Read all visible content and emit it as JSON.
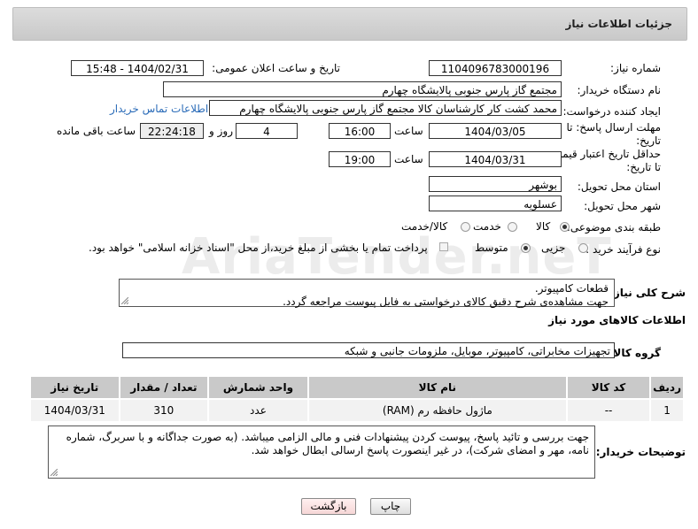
{
  "header": {
    "title": "جزئیات اطلاعات نیاز"
  },
  "fields": {
    "need_number_label": "شماره نیاز:",
    "need_number": "1104096783000196",
    "announce_label": "تاریخ و ساعت اعلان عمومی:",
    "announce_value": "1404/02/31 - 15:48",
    "buyer_org_label": "نام دستگاه خریدار:",
    "buyer_org": "مجتمع گاز پارس جنوبی  پالایشگاه چهارم",
    "creator_label": "ایجاد کننده درخواست:",
    "creator": "محمد کشت کار کارشناسان کالا مجتمع گاز پارس جنوبی  پالایشگاه چهارم",
    "buyer_contact_link": "اطلاعات تماس خریدار",
    "deadline_label_1": "مهلت ارسال پاسخ: تا",
    "deadline_label_2": "تاریخ:",
    "deadline_date": "1404/03/05",
    "time_label": "ساعت",
    "deadline_time": "16:00",
    "days_value": "4",
    "days_label": "روز و",
    "remaining_time": "22:24:18",
    "remaining_label": "ساعت باقی مانده",
    "validity_label_1": "حداقل تاریخ اعتبار قیمت:",
    "validity_label_2": "تا تاریخ:",
    "validity_date": "1404/03/31",
    "validity_time_label": "ساعت",
    "validity_time": "19:00",
    "province_label": "استان محل تحویل:",
    "province": "بوشهر",
    "city_label": "شهر محل تحویل:",
    "city": "عسلویه",
    "category_label": "طبقه بندی موضوعی:",
    "category_options": [
      "کالا",
      "خدمت",
      "کالا/خدمت"
    ],
    "process_label": "نوع فرآیند خرید :",
    "process_options": [
      "جزیی",
      "متوسط"
    ],
    "payment_note": "پرداخت تمام یا بخشی از مبلغ خرید،از محل \"اسناد خزانه اسلامی\" خواهد بود.",
    "description_label": "شرح کلی نیاز:",
    "description_line1": "قطعات کامپیوتر.",
    "description_line2": "جهت مشاهده‌ی شرح دقیق کالای درخواستی به فایل پیوست مراجعه گردد.",
    "items_section_title": "اطلاعات کالاهای مورد نیاز",
    "goods_group_label": "گروه کالا:",
    "goods_group": "تجهیزات مخابراتی، کامپیوتر، موبایل، ملزومات جانبی و شبکه",
    "buyer_notes_label": "توضیحات خریدار:",
    "buyer_notes_line1": "جهت بررسی و تائید پاسخ، پیوست کردن پیشنهادات فنی و مالی الزامی میباشد. (به صورت جداگانه و با سربرگ، شماره",
    "buyer_notes_line2": "نامه، مهر و امضای شرکت)، در غیر اینصورت پاسخ ارسالی ابطال خواهد شد."
  },
  "table": {
    "headers": [
      "ردیف",
      "کد کالا",
      "نام کالا",
      "واحد شمارش",
      "تعداد / مقدار",
      "تاریخ نیاز"
    ],
    "rows": [
      [
        "1",
        "--",
        "ماژول حافظه رم (RAM)",
        "عدد",
        "310",
        "1404/03/31"
      ]
    ]
  },
  "buttons": {
    "print": "چاپ",
    "back": "بازگشت"
  },
  "watermark": "AriaTender.neT",
  "colors": {
    "link": "#2a6bb8",
    "header_bg": "#d0d0d0",
    "back_button_bg": "#fbe3e3"
  }
}
